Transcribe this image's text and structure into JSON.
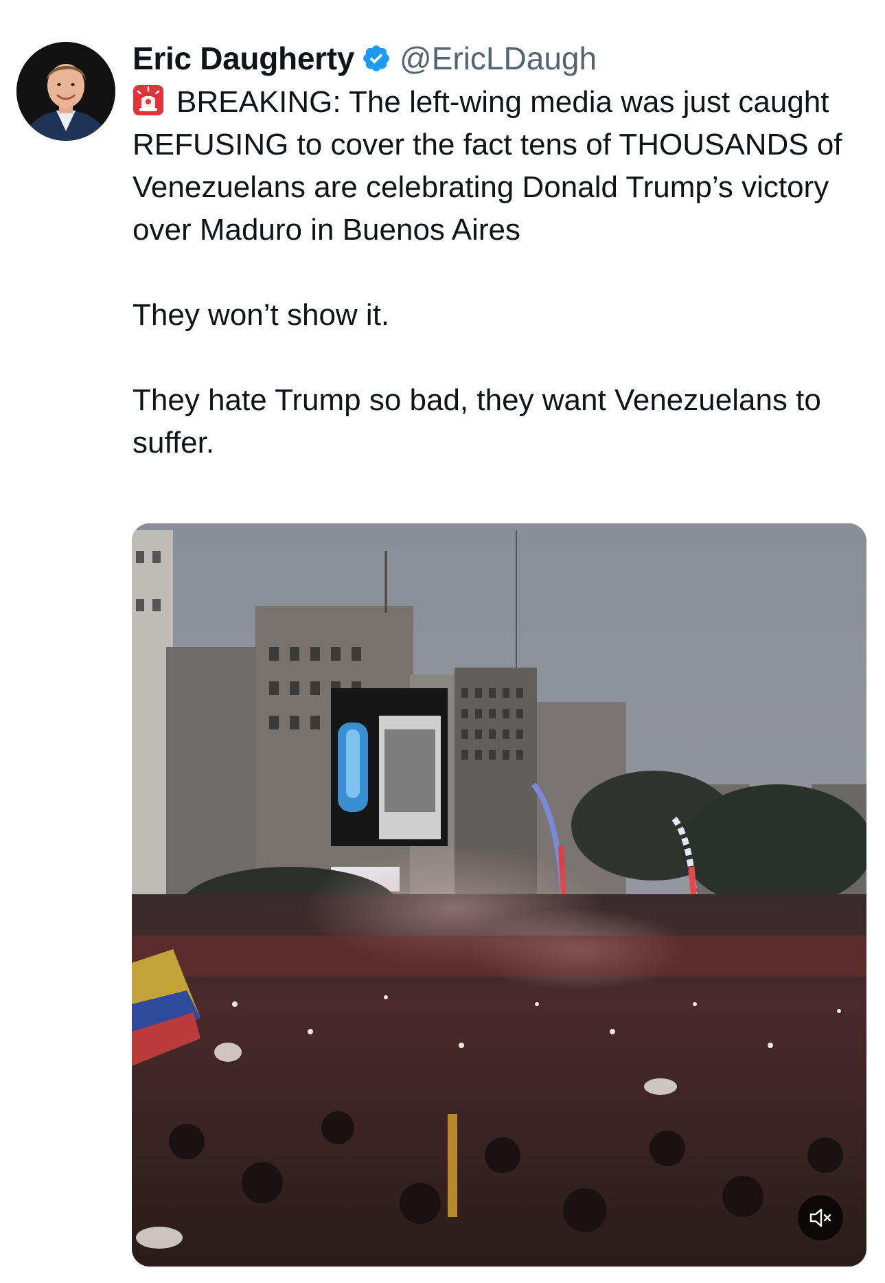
{
  "author": {
    "display_name": "Eric Daugherty",
    "handle": "@EricLDaugh",
    "verified": true,
    "avatar_icon": "profile-photo"
  },
  "tweet": {
    "line1": "BREAKING: The left-wing media was just caught REFUSING to cover the fact tens of THOUSANDS of Venezuelans are celebrating Donald Trump’s victory over Maduro in Buenos Aires",
    "line2": "They won’t show it.",
    "line3": "They hate Trump so bad, they want Venezuelans to suffer.",
    "leading_emoji": "siren-icon"
  },
  "media": {
    "type": "video",
    "description_icon": "crowd-video-thumbnail",
    "mute_icon": "speaker-muted-icon"
  },
  "colors": {
    "text": "#0f1419",
    "secondary": "#536471",
    "verified_blue": "#1d9bf0",
    "siren_red": "#e0333a"
  }
}
